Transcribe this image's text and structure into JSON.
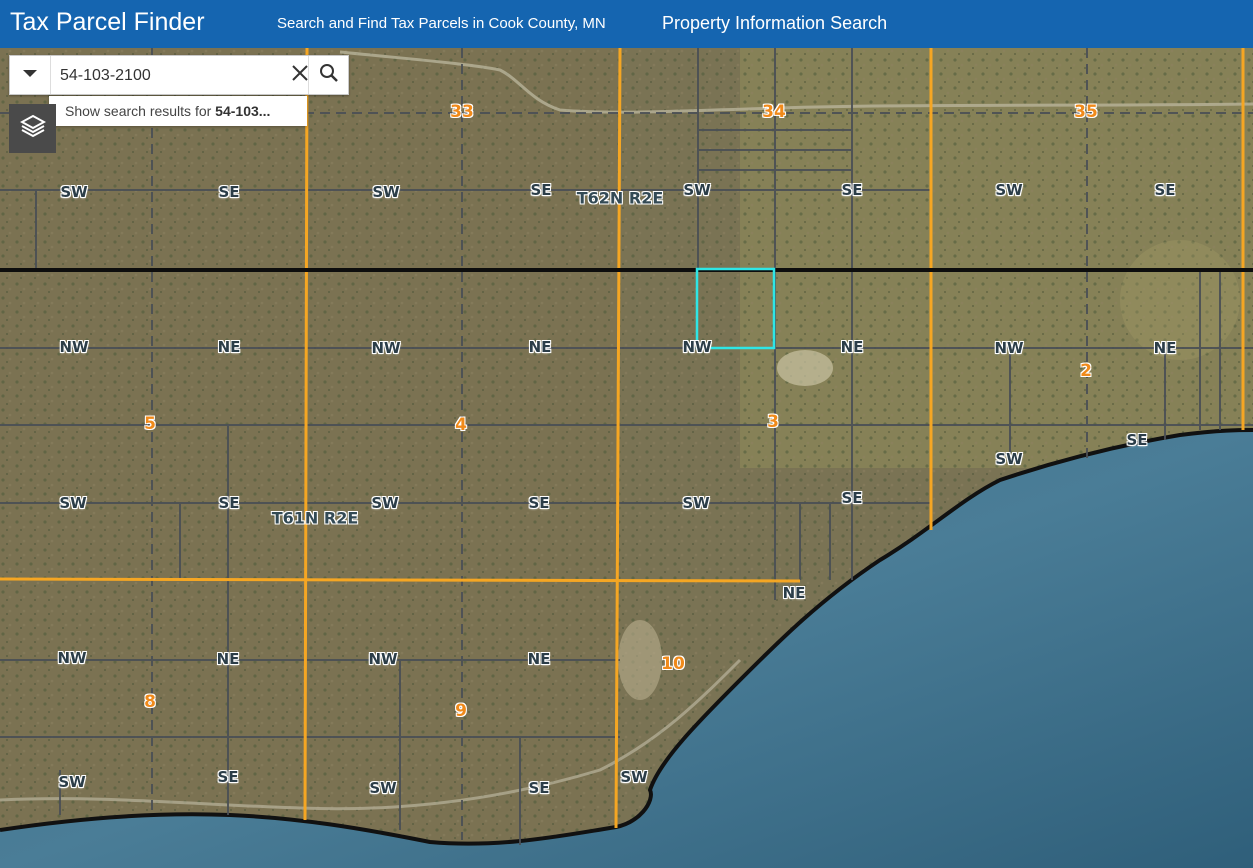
{
  "header": {
    "title": "Tax Parcel Finder",
    "subtitle": "Search and Find Tax Parcels in Cook County, MN",
    "property_link": "Property Information Search"
  },
  "search": {
    "value": "54-103-2100",
    "suggestion_prefix": "Show search results for ",
    "suggestion_term": "54-103..."
  },
  "icons": {
    "dropdown": "chevron-down-icon",
    "clear": "close-icon",
    "search": "search-icon",
    "layers": "layers-icon"
  },
  "colors": {
    "header": "#1565b0",
    "section_line": "#f5a623",
    "township_line": "#000000",
    "parcel_line": "#4a4f55",
    "selected_parcel": "#2ee6e6",
    "lake": "#3f6f8a"
  },
  "map": {
    "sections": [
      "33",
      "34",
      "35",
      "5",
      "4",
      "3",
      "2",
      "8",
      "9",
      "10"
    ],
    "townships": [
      "T62N R2E",
      "T61N R2E"
    ],
    "quarters": {
      "row1": [
        "SW",
        "SE",
        "SW",
        "SE",
        "SW",
        "SE",
        "SW",
        "SE"
      ],
      "row2": [
        "NW",
        "NE",
        "NW",
        "NE",
        "NW",
        "NE",
        "NW",
        "NE"
      ],
      "row3": [
        "SW",
        "SE",
        "SW",
        "SE",
        "SW",
        "SE",
        "SW",
        "SE"
      ],
      "row4": [
        "NW",
        "NE",
        "NW",
        "NE",
        "NE"
      ],
      "row5": [
        "SW",
        "SE",
        "SW",
        "SE",
        "SW"
      ]
    }
  }
}
